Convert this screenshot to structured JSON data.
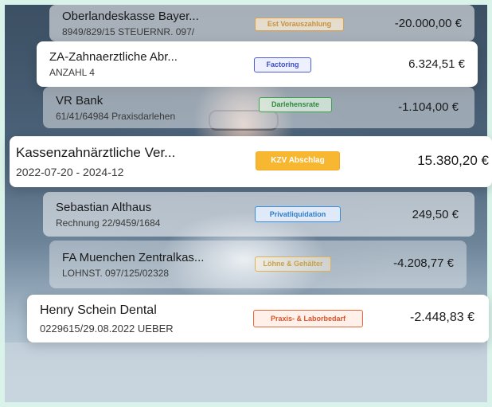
{
  "transactions": [
    {
      "name": "Oberlandeskasse Bayer...",
      "sub": "8949/829/15 STEUERNR. 097/",
      "category": "Est Vorauszahlung",
      "amount": "-20.000,00 €",
      "badge_color": "#d9a24a"
    },
    {
      "name": "ZA-Zahnaerztliche Abr...",
      "sub": "ANZAHL 4",
      "category": "Factoring",
      "amount": "6.324,51 €",
      "badge_color": "#4a5fd9"
    },
    {
      "name": "VR Bank",
      "sub": "61/41/64984 Praxisdarlehen",
      "category": "Darlehensrate",
      "amount": "-1.104,00 €",
      "badge_color": "#3fa34d"
    },
    {
      "name": "Kassenzahnärztliche Ver...",
      "sub": "2022-07-20 - 2024-12",
      "category": "KZV Abschlag",
      "amount": "15.380,20 €",
      "badge_color": "#f5a623"
    },
    {
      "name": "Sebastian Althaus",
      "sub": "Rechnung 22/9459/1684",
      "category": "Privatliquidation",
      "amount": "249,50 €",
      "badge_color": "#3b8fd9"
    },
    {
      "name": "FA Muenchen Zentralkas...",
      "sub": "LOHNST. 097/125/02328",
      "category": "Löhne & Gehälter",
      "amount": "-4.208,77 €",
      "badge_color": "#e0b050"
    },
    {
      "name": "Henry Schein Dental",
      "sub": "0229615/29.08.2022 UEBER",
      "category": "Praxis- & Laborbedarf",
      "amount": "-2.448,83 €",
      "badge_color": "#e8663a"
    }
  ]
}
